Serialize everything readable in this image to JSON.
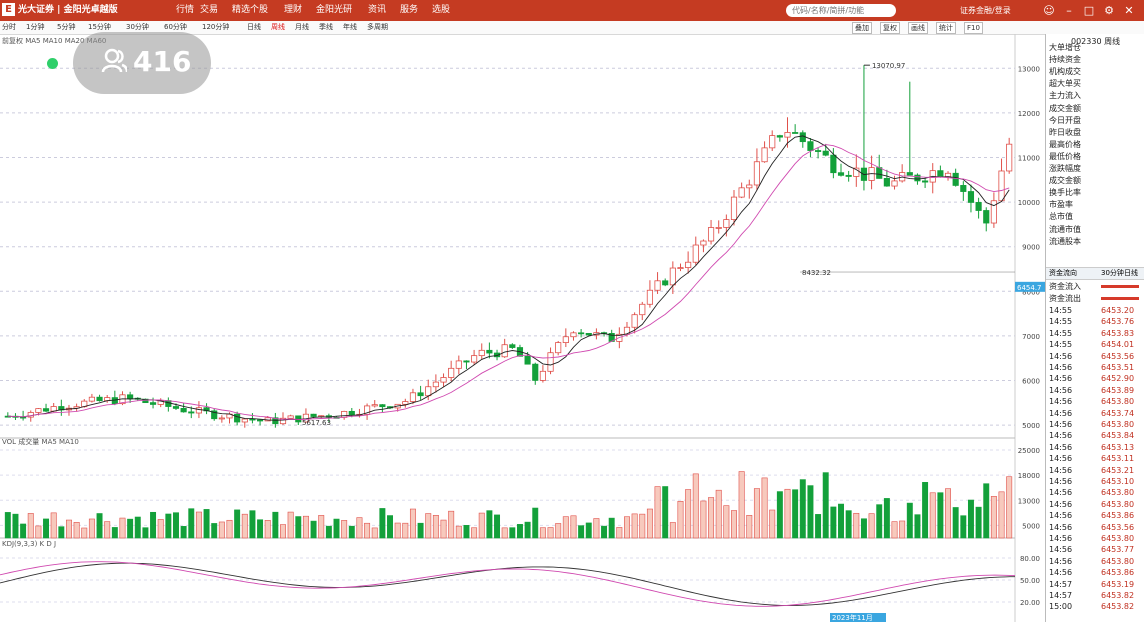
{
  "header": {
    "logo": "E",
    "broker": "光大证券",
    "product": "金阳光卓越版",
    "menus": [
      "行情",
      "交易",
      "精选个股",
      "理财",
      "金阳光研",
      "资讯",
      "服务",
      "选股"
    ],
    "search_placeholder": "代码/名称/简拼/功能",
    "account": "证券金融/登录"
  },
  "toolbar": {
    "periods": [
      "分时",
      "1分钟",
      "5分钟",
      "15分钟",
      "30分钟",
      "60分钟",
      "120分钟",
      "日线",
      "周线",
      "月线",
      "季线",
      "年线",
      "多周期"
    ],
    "active_period": "周线",
    "right_tools": [
      "叠加",
      "复权",
      "画线",
      "统计",
      "F10"
    ],
    "ma_label": "前复权 MA5 MA10 MA20 MA60"
  },
  "volume_label": "VOL 成交量 MA5 MA10",
  "kdj_label": "KDJ(9,3,3) K D J",
  "overlay": {
    "viewers": "416"
  },
  "chart_data": {
    "type": "candlestick",
    "title": "",
    "price_axis_ticks": [
      "13000",
      "12000",
      "11000",
      "10000",
      "9000",
      "8000",
      "7000",
      "6000",
      "5000"
    ],
    "max_label": "13070.97",
    "min_label": "5617.63",
    "mid_label": "8432.32",
    "current_price_label": "6454.7",
    "volume_axis_ticks": [
      "25000",
      "18000",
      "13000",
      "5000"
    ],
    "kdj_axis_ticks": [
      "80.00",
      "50.00",
      "20.00"
    ],
    "last_date_label": "2023年11月"
  },
  "sidebar": {
    "code_label": "002330 周线",
    "items": [
      "大单增仓",
      "持续资金",
      "机构成交",
      "超大单买",
      "主力流入",
      "成交金额",
      "今日开盘",
      "昨日收盘",
      "最高价格",
      "最低价格",
      "涨跌幅度",
      "成交金额",
      "换手比率",
      "市盈率",
      "总市值",
      "流通市值",
      "流通股本"
    ],
    "tabs": [
      "资金流向",
      "30分钟",
      "日线"
    ],
    "flow_in_label": "资金流入",
    "flow_out_label": "资金流出",
    "ticks": [
      {
        "t": "14:55",
        "p": "6453.20"
      },
      {
        "t": "14:55",
        "p": "6453.76"
      },
      {
        "t": "14:55",
        "p": "6453.83"
      },
      {
        "t": "14:55",
        "p": "6454.01"
      },
      {
        "t": "14:56",
        "p": "6453.56"
      },
      {
        "t": "14:56",
        "p": "6453.51"
      },
      {
        "t": "14:56",
        "p": "6452.90"
      },
      {
        "t": "14:56",
        "p": "6453.89"
      },
      {
        "t": "14:56",
        "p": "6453.80"
      },
      {
        "t": "14:56",
        "p": "6453.74"
      },
      {
        "t": "14:56",
        "p": "6453.80"
      },
      {
        "t": "14:56",
        "p": "6453.84"
      },
      {
        "t": "14:56",
        "p": "6453.13"
      },
      {
        "t": "14:56",
        "p": "6453.11"
      },
      {
        "t": "14:56",
        "p": "6453.21"
      },
      {
        "t": "14:56",
        "p": "6453.10"
      },
      {
        "t": "14:56",
        "p": "6453.80"
      },
      {
        "t": "14:56",
        "p": "6453.80"
      },
      {
        "t": "14:56",
        "p": "6453.86"
      },
      {
        "t": "14:56",
        "p": "6453.56"
      },
      {
        "t": "14:56",
        "p": "6453.80"
      },
      {
        "t": "14:56",
        "p": "6453.77"
      },
      {
        "t": "14:56",
        "p": "6453.80"
      },
      {
        "t": "14:56",
        "p": "6453.86"
      },
      {
        "t": "14:57",
        "p": "6453.19"
      },
      {
        "t": "14:57",
        "p": "6453.82"
      },
      {
        "t": "15:00",
        "p": "6453.82"
      }
    ]
  }
}
